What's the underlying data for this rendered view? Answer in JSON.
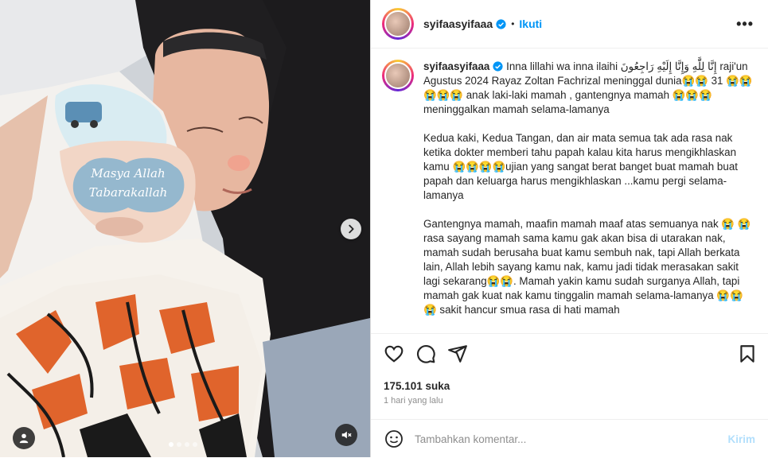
{
  "post": {
    "username": "syifaasyifaaa",
    "separator": "•",
    "follow_label": "Ikuti",
    "more_label": "•••",
    "sticker_line1": "Masya Allah",
    "sticker_line2": "Tabarakallah",
    "caption": {
      "username": "syifaasyifaaa",
      "paragraphs": [
        "Inna lillahi wa inna ilaihi إِنَّا لِلَّٰهِ وَإِنَّا إِلَيْهِ رَاجِعُونَ raji'un\nAgustus 2024 Rayaz Zoltan Fachrizal meninggal dunia😭😭 31 😭😭😭😭😭 anak laki-laki mamah , gantengnya mamah 😭😭😭 meninggalkan mamah selama-lamanya",
        "Kedua kaki, Kedua Tangan, dan air mata semua tak ada rasa nak ketika dokter memberi tahu papah kalau kita harus mengikhlaskan kamu 😭😭😭😭ujian yang sangat berat banget buat mamah buat papah dan keluarga harus mengikhlaskan ...kamu pergi selama-lamanya",
        "Gantengnya mamah, maafin mamah maaf atas semuanya nak 😭 😭rasa sayang mamah sama kamu gak akan bisa di utarakan nak, mamah sudah berusaha buat kamu sembuh nak, tapi Allah berkata lain, Allah lebih sayang kamu nak, kamu jadi tidak merasakan sakit lagi sekarang😭😭. Mamah yakin kamu sudah surganya Allah, tapi mamah gak kuat nak kamu tinggalin mamah selama-lamanya 😭😭😭 sakit hancur smua rasa di hati mamah"
      ]
    },
    "likes": "175.101 suka",
    "time_ago": "1 hari yang lalu",
    "comment_placeholder": "Tambahkan komentar...",
    "post_label": "Kirim",
    "carousel": {
      "slides": 4,
      "active": 1
    }
  },
  "colors": {
    "link": "#0095f6",
    "post_disabled": "#b2dffc",
    "muted": "#8e8e8e"
  }
}
